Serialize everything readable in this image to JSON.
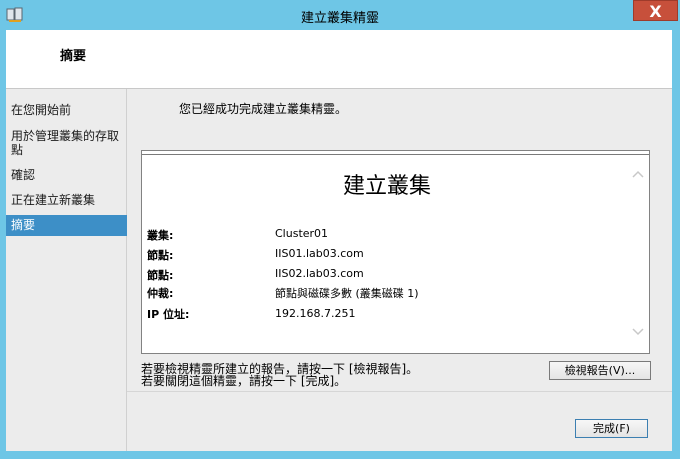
{
  "window": {
    "title": "建立叢集精靈",
    "close_label": "X"
  },
  "header": {
    "title": "摘要"
  },
  "nav": {
    "items": [
      {
        "label": "在您開始前"
      },
      {
        "label": "用於管理叢集的存取點"
      },
      {
        "label": "確認"
      },
      {
        "label": "正在建立新叢集"
      },
      {
        "label": "摘要",
        "selected": true
      }
    ]
  },
  "main": {
    "intro": "您已經成功完成建立叢集精靈。",
    "report": {
      "heading": "建立叢集",
      "rows": [
        {
          "label": "叢集:",
          "value": "Cluster01"
        },
        {
          "label": "節點:",
          "value": "IIS01.lab03.com"
        },
        {
          "label": "節點:",
          "value": "IIS02.lab03.com"
        },
        {
          "label": "仲裁:",
          "value": "節點與磁碟多數 (叢集磁碟 1)"
        },
        {
          "label": "IP 位址:",
          "value": "192.168.7.251"
        }
      ]
    },
    "note_line1": "若要檢視精靈所建立的報告，請按一下 [檢視報告]。",
    "note_line2": "若要關閉這個精靈，請按一下 [完成]。",
    "view_report_label": "檢視報告(V)...",
    "finish_label": "完成(F)"
  },
  "colors": {
    "accent": "#3d8fc7",
    "frame": "#6ec6e6",
    "close": "#c7503b"
  }
}
